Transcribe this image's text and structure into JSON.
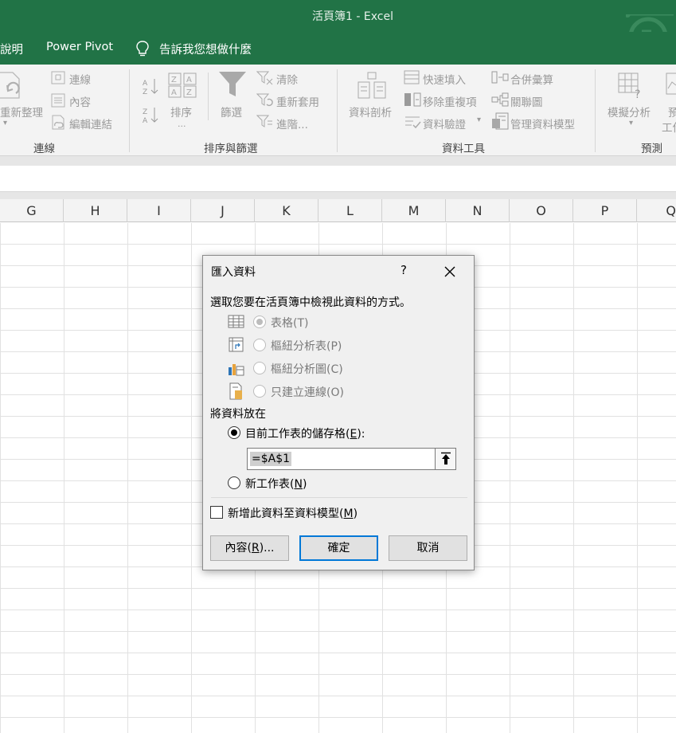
{
  "window": {
    "title": "活頁簿1  -  Excel"
  },
  "menu": {
    "items": [
      "說明",
      "Power Pivot"
    ],
    "tell_me": "告訴我您想做什麼"
  },
  "ribbon": {
    "connections": {
      "refresh_all": "重新整理",
      "connections": "連線",
      "properties": "內容",
      "edit_links": "編輯連結",
      "group_label": "連線"
    },
    "sort_filter": {
      "sort": "排序",
      "sort_more": "...",
      "filter": "篩選",
      "clear": "清除",
      "reapply": "重新套用",
      "advanced": "進階...",
      "group_label": "排序與篩選"
    },
    "data_tools": {
      "text_to_columns": "資料剖析",
      "flash_fill": "快速填入",
      "remove_duplicates": "移除重複項",
      "data_validation": "資料驗證",
      "consolidate": "合併彙算",
      "relationships": "關聯圖",
      "manage_data_model": "管理資料模型",
      "group_label": "資料工具"
    },
    "forecast": {
      "what_if": "模擬分析",
      "forecast_sheet_partial_1": "預",
      "forecast_sheet_partial_2": "工作",
      "group_label": "預測"
    }
  },
  "columns": [
    "G",
    "H",
    "I",
    "J",
    "K",
    "L",
    "M",
    "N",
    "O",
    "P",
    "Q"
  ],
  "dialog": {
    "title": "匯入資料",
    "help": "?",
    "prompt": "選取您要在活頁簿中檢視此資料的方式。",
    "view_options": [
      {
        "label": "表格(T)"
      },
      {
        "label": "樞紐分析表(P)"
      },
      {
        "label": "樞紐分析圖(C)"
      },
      {
        "label": "只建立連線(O)"
      }
    ],
    "location_label": "將資料放在",
    "existing_sheet": {
      "label_pre": "目前工作表的儲存格(",
      "key": "E",
      "label_post": "):"
    },
    "cell_ref": "=$A$1",
    "new_sheet": {
      "label_pre": "新工作表(",
      "key": "N",
      "label_post": ")"
    },
    "add_to_model": {
      "label_pre": "新增此資料至資料模型(",
      "key": "M",
      "label_post": ")"
    },
    "buttons": {
      "properties": {
        "pre": "內容(",
        "key": "R",
        "post": ")..."
      },
      "ok": "確定",
      "cancel": "取消"
    }
  }
}
